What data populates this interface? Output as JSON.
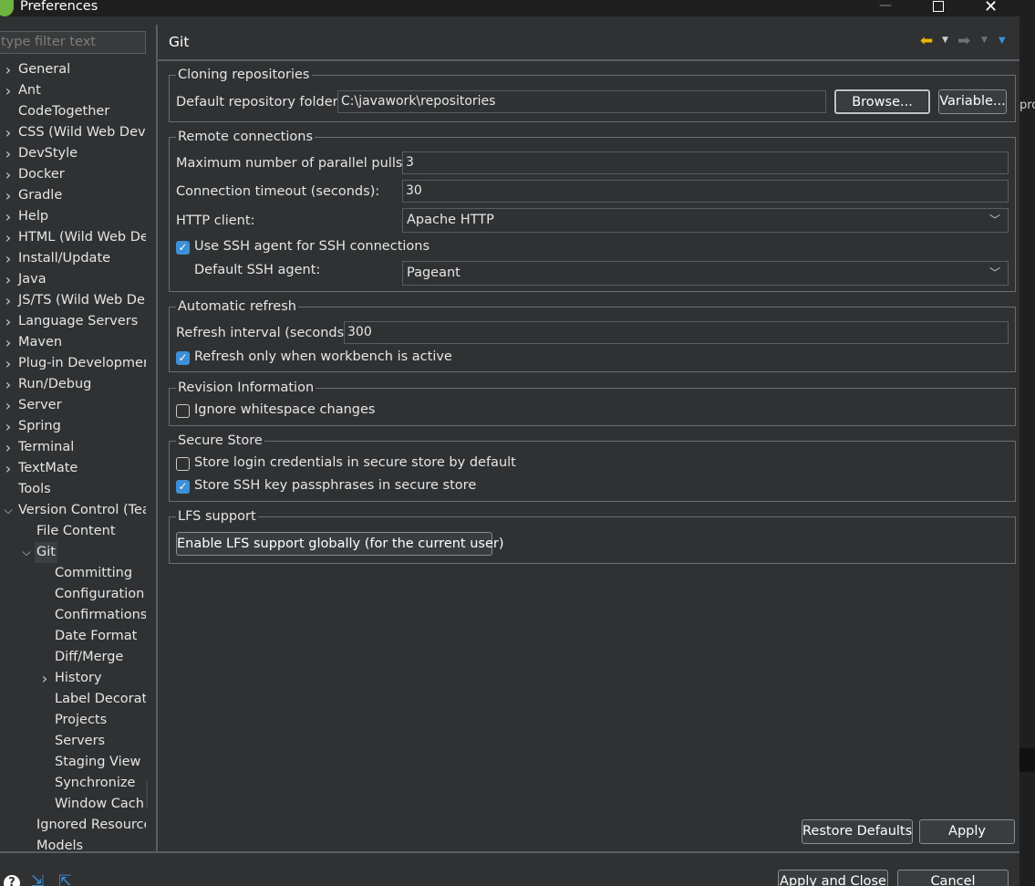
{
  "window": {
    "title": "Preferences"
  },
  "left": {
    "filter_placeholder": "type filter text",
    "tree": [
      {
        "label": "General",
        "level": 0,
        "chevron": "right"
      },
      {
        "label": "Ant",
        "level": 0,
        "chevron": "right"
      },
      {
        "label": "CodeTogether",
        "level": 0,
        "chevron": ""
      },
      {
        "label": "CSS (Wild Web Dev",
        "level": 0,
        "chevron": "right"
      },
      {
        "label": "DevStyle",
        "level": 0,
        "chevron": "right"
      },
      {
        "label": "Docker",
        "level": 0,
        "chevron": "right"
      },
      {
        "label": "Gradle",
        "level": 0,
        "chevron": "right"
      },
      {
        "label": "Help",
        "level": 0,
        "chevron": "right"
      },
      {
        "label": "HTML (Wild Web De",
        "level": 0,
        "chevron": "right"
      },
      {
        "label": "Install/Update",
        "level": 0,
        "chevron": "right"
      },
      {
        "label": "Java",
        "level": 0,
        "chevron": "right"
      },
      {
        "label": "JS/TS (Wild Web De",
        "level": 0,
        "chevron": "right"
      },
      {
        "label": "Language Servers",
        "level": 0,
        "chevron": "right"
      },
      {
        "label": "Maven",
        "level": 0,
        "chevron": "right"
      },
      {
        "label": "Plug-in Developmen",
        "level": 0,
        "chevron": "right"
      },
      {
        "label": "Run/Debug",
        "level": 0,
        "chevron": "right"
      },
      {
        "label": "Server",
        "level": 0,
        "chevron": "right"
      },
      {
        "label": "Spring",
        "level": 0,
        "chevron": "right"
      },
      {
        "label": "Terminal",
        "level": 0,
        "chevron": "right"
      },
      {
        "label": "TextMate",
        "level": 0,
        "chevron": "right"
      },
      {
        "label": "Tools",
        "level": 0,
        "chevron": ""
      },
      {
        "label": "Version Control (Tea",
        "level": 0,
        "chevron": "down"
      },
      {
        "label": "File Content",
        "level": 1,
        "chevron": ""
      },
      {
        "label": "Git",
        "level": 1,
        "chevron": "down",
        "selected": true
      },
      {
        "label": "Committing",
        "level": 2,
        "chevron": ""
      },
      {
        "label": "Configuration",
        "level": 2,
        "chevron": ""
      },
      {
        "label": "Confirmations",
        "level": 2,
        "chevron": ""
      },
      {
        "label": "Date Format",
        "level": 2,
        "chevron": ""
      },
      {
        "label": "Diff/Merge",
        "level": 2,
        "chevron": ""
      },
      {
        "label": "History",
        "level": 2,
        "chevron": "right"
      },
      {
        "label": "Label Decorat",
        "level": 2,
        "chevron": ""
      },
      {
        "label": "Projects",
        "level": 2,
        "chevron": ""
      },
      {
        "label": "Servers",
        "level": 2,
        "chevron": ""
      },
      {
        "label": "Staging View",
        "level": 2,
        "chevron": ""
      },
      {
        "label": "Synchronize",
        "level": 2,
        "chevron": ""
      },
      {
        "label": "Window Cach",
        "level": 2,
        "chevron": ""
      },
      {
        "label": "Ignored Resource",
        "level": 1,
        "chevron": ""
      },
      {
        "label": "Models",
        "level": 1,
        "chevron": ""
      }
    ]
  },
  "page": {
    "title": "Git",
    "cloning": {
      "title": "Cloning repositories",
      "folder_label": "Default repository folder:",
      "folder_value": "C:\\javawork\\repositories",
      "browse_label": "Browse...",
      "variable_label": "Variable..."
    },
    "remote": {
      "title": "Remote connections",
      "pulls_label": "Maximum number of parallel pulls:",
      "pulls_value": "3",
      "timeout_label": "Connection timeout (seconds):",
      "timeout_value": "30",
      "http_label": "HTTP client:",
      "http_value": "Apache HTTP",
      "ssh_agent_check_label": "Use SSH agent for SSH connections",
      "ssh_agent_checked": true,
      "default_agent_label": "Default SSH agent:",
      "default_agent_value": "Pageant"
    },
    "refresh": {
      "title": "Automatic refresh",
      "interval_label": "Refresh interval (seconds):",
      "interval_value": "300",
      "active_label": "Refresh only when workbench is active",
      "active_checked": true
    },
    "revision": {
      "title": "Revision Information",
      "whitespace_label": "Ignore whitespace changes",
      "whitespace_checked": false
    },
    "secure": {
      "title": "Secure Store",
      "login_label": "Store login credentials in secure store by default",
      "login_checked": false,
      "ssh_label": "Store SSH key passphrases in secure store",
      "ssh_checked": true
    },
    "lfs": {
      "title": "LFS support",
      "button_label": "Enable LFS support globally (for the current user)"
    },
    "restore_defaults_label": "Restore Defaults",
    "apply_label": "Apply"
  },
  "footer": {
    "apply_close_label": "Apply and Close",
    "cancel_label": "Cancel"
  },
  "background_window": {
    "text": "pro"
  },
  "colors": {
    "accent": "#3d8fd6",
    "back_arrow": "#f0b400",
    "background": "#2f3133"
  }
}
